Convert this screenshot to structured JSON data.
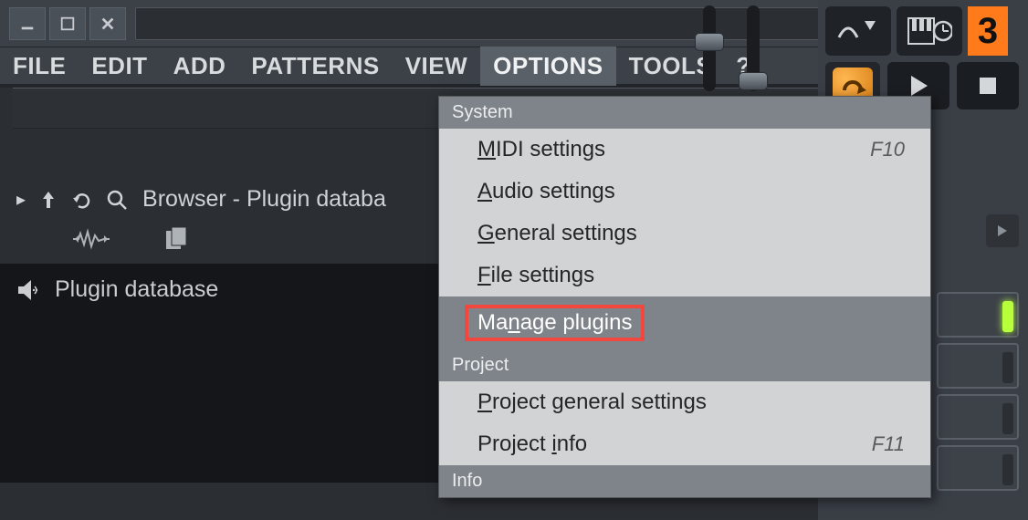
{
  "window": {
    "title": ""
  },
  "menubar": {
    "items": [
      "FILE",
      "EDIT",
      "ADD",
      "PATTERNS",
      "VIEW",
      "OPTIONS",
      "TOOLS",
      "?"
    ],
    "active_index": 5
  },
  "browser": {
    "title": "Browser - Plugin databa",
    "body_label": "Plugin database"
  },
  "dropdown": {
    "sections": [
      {
        "label": "System",
        "items": [
          {
            "label_pre": "",
            "label_ul": "M",
            "label_post": "IDI settings",
            "shortcut": "F10",
            "highlight": false
          },
          {
            "label_pre": "",
            "label_ul": "A",
            "label_post": "udio settings",
            "shortcut": "",
            "highlight": false
          },
          {
            "label_pre": "",
            "label_ul": "G",
            "label_post": "eneral settings",
            "shortcut": "",
            "highlight": false
          },
          {
            "label_pre": "",
            "label_ul": "F",
            "label_post": "ile settings",
            "shortcut": "",
            "highlight": false
          },
          {
            "label_pre": "Ma",
            "label_ul": "n",
            "label_post": "age plugins",
            "shortcut": "",
            "highlight": true
          }
        ]
      },
      {
        "label": "Project",
        "items": [
          {
            "label_pre": "",
            "label_ul": "P",
            "label_post": "roject general settings",
            "shortcut": "",
            "highlight": false
          },
          {
            "label_pre": "Project ",
            "label_ul": "i",
            "label_post": "nfo",
            "shortcut": "F11",
            "highlight": false
          }
        ]
      },
      {
        "label": "Info",
        "items": []
      }
    ]
  },
  "right": {
    "number": "3"
  },
  "sliders": {
    "a_pos_pct": 32,
    "b_pos_pct": 78
  }
}
